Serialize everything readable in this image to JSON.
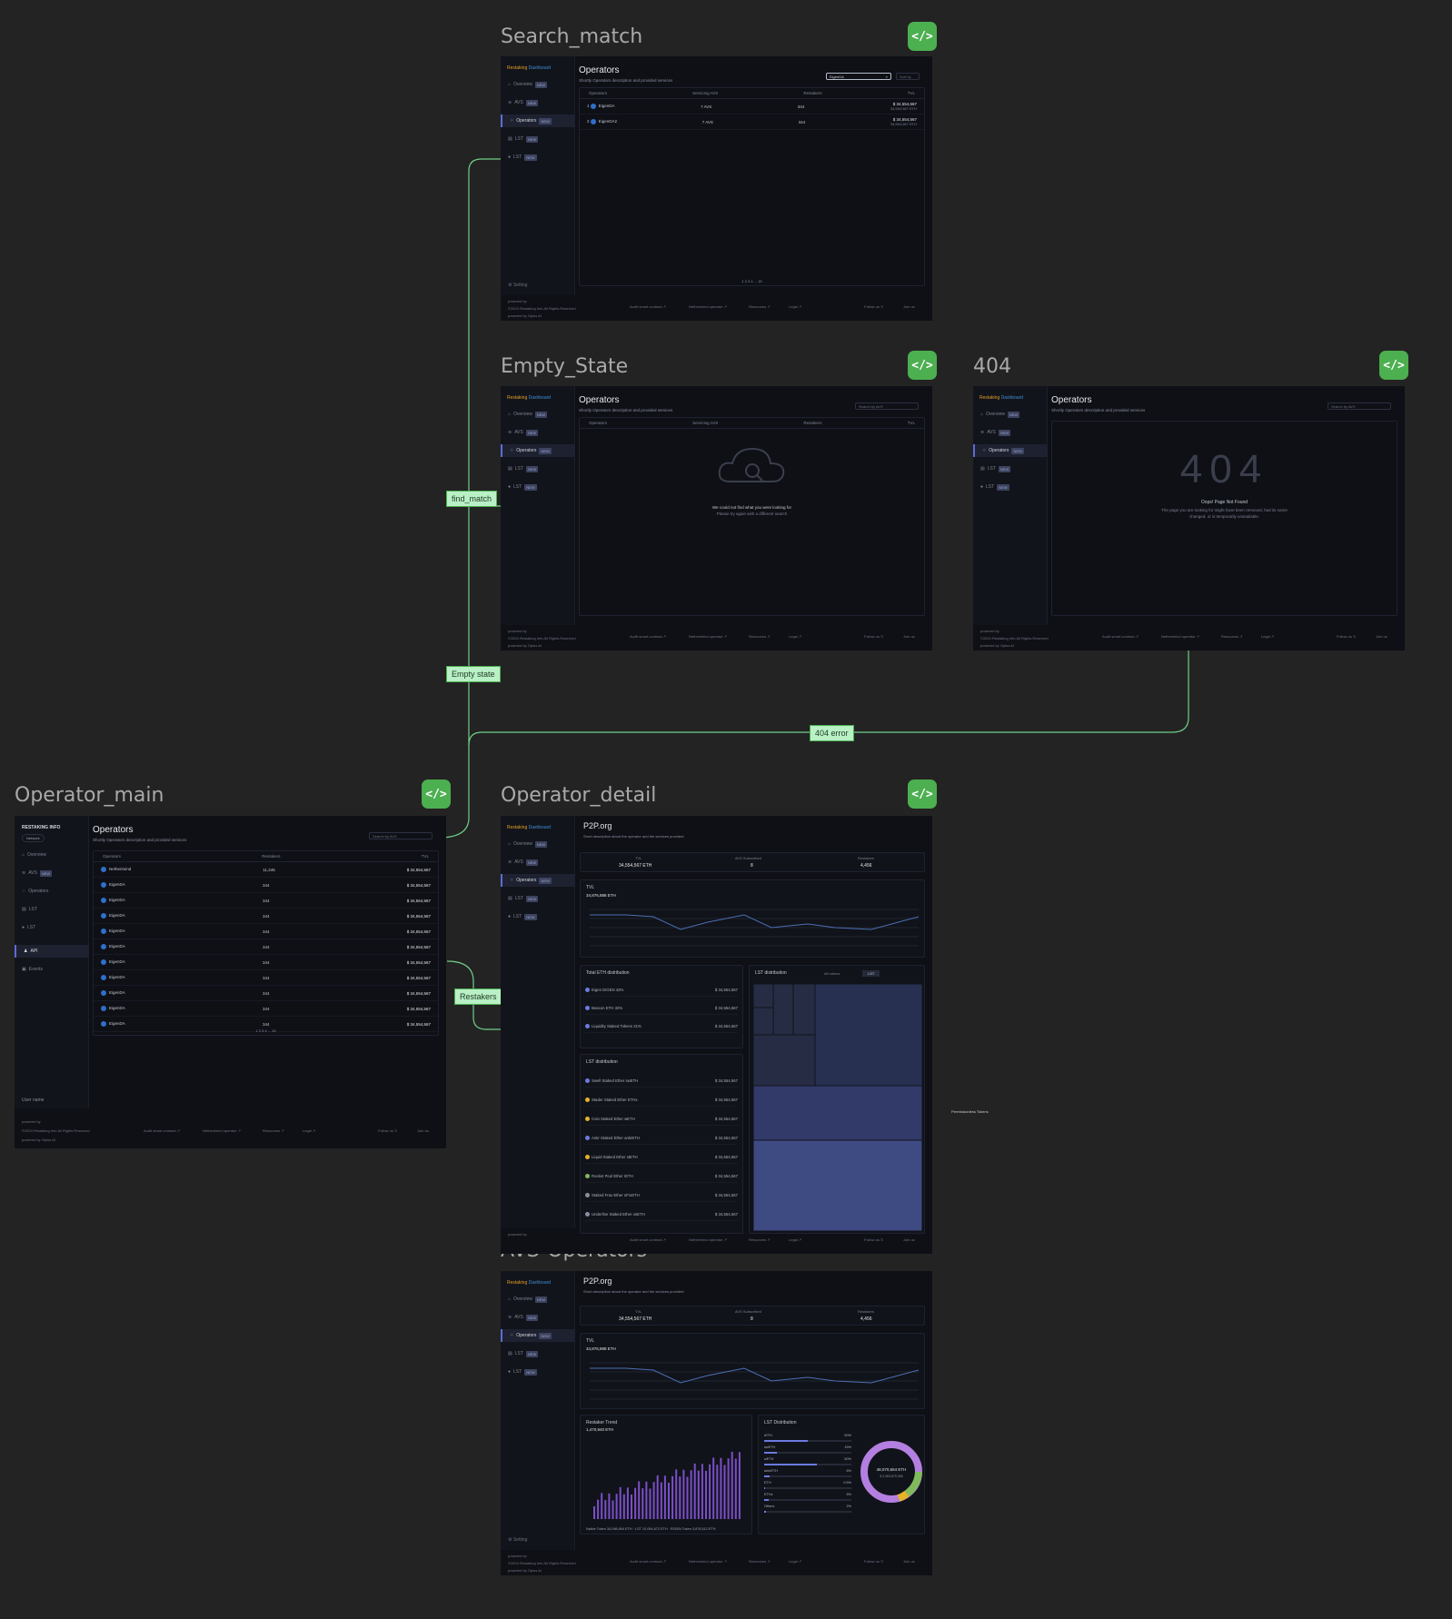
{
  "frames": {
    "search_match": "Search_match",
    "empty_state": "Empty_State",
    "not_found": "404",
    "operator_main": "Operator_main",
    "operator_detail": "Operator_detail",
    "avs_operators": "AVS-Operators"
  },
  "code_icon": "</>",
  "connectors": {
    "find_match": "find_match",
    "empty_state": "Empty state",
    "error_404": "404 error",
    "restakers": "Restakers"
  },
  "sidebar": {
    "brand1": "Restaking",
    "brand2": "Dashboard",
    "overview": "Overview",
    "avs": "AVS",
    "operators": "Operators",
    "lst": "LST",
    "lst2": "LST",
    "setting": "Setting",
    "badge": "NEW"
  },
  "main_sidebar": {
    "brand": "RESTAKING INFO",
    "network": "Network",
    "overview": "Overview",
    "avs": "AVS",
    "operators": "Operators",
    "lst": "LST",
    "lst2": "LST",
    "api": "API",
    "events": "Events",
    "user": "User name"
  },
  "page": {
    "title": "Operators",
    "subtitle": "Shortly Operators description and provided services",
    "search_value": "EigenDA",
    "search_placeholder": "Search by AVS",
    "sort": "Sort by"
  },
  "table": {
    "col_operators": "Operators",
    "col_avs": "Servicing AVS",
    "col_restakers": "Restakers",
    "col_tvl": "TVL"
  },
  "search_rows": [
    {
      "idx": "1",
      "name": "EigenDA",
      "avs": "7 AVS",
      "restakers": "344",
      "tvl": "$ 34,554,567",
      "sub": "34,554,567 ETH"
    },
    {
      "idx": "2",
      "name": "EigenDA2",
      "avs": "7 AVS",
      "restakers": "344",
      "tvl": "$ 34,554,567",
      "sub": "34,554,567 ETH"
    }
  ],
  "pagination": "1  2  3  4  ...  15",
  "empty": {
    "line1": "We could not find what you were looking for",
    "line2": "Please try again with a different search"
  },
  "not_found": {
    "big": "404",
    "title": "Oops! Page Not Found",
    "desc1": "The page you are looking for might have been removed, had its name",
    "desc2": "changed, or is temporarily unavailable."
  },
  "footer": {
    "powered": "powered by",
    "copyright": "©2024 Restaking Info All Rights Reserved",
    "powered2": "powered by Oplus AI",
    "audit": "Audit smart contract ↗",
    "network": "Netherimind operator ↗",
    "resources": "Resources ↗",
    "legal": "Legal ↗",
    "follow": "Follow us 𝕏",
    "join": "Join us"
  },
  "main_rows": [
    {
      "name": "Netherimind",
      "restakers": "11,345",
      "tvl": "$ 34,554,567"
    },
    {
      "name": "EigenDA",
      "restakers": "344",
      "tvl": "$ 34,554,567"
    },
    {
      "name": "EigenDA",
      "restakers": "344",
      "tvl": "$ 34,554,567"
    },
    {
      "name": "EigenDA",
      "restakers": "344",
      "tvl": "$ 34,554,567"
    },
    {
      "name": "EigenDA",
      "restakers": "344",
      "tvl": "$ 34,554,567"
    },
    {
      "name": "EigenDA",
      "restakers": "344",
      "tvl": "$ 34,554,567"
    },
    {
      "name": "EigenDA",
      "restakers": "344",
      "tvl": "$ 34,554,567"
    },
    {
      "name": "EigenDA",
      "restakers": "344",
      "tvl": "$ 34,554,567"
    },
    {
      "name": "EigenDA",
      "restakers": "344",
      "tvl": "$ 34,554,567"
    },
    {
      "name": "EigenDA",
      "restakers": "344",
      "tvl": "$ 34,554,567"
    },
    {
      "name": "EigenDA",
      "restakers": "344",
      "tvl": "$ 34,554,567"
    }
  ],
  "detail": {
    "title": "P2P.org",
    "desc": "Short description about the operator and the services provided",
    "tvl_label": "TVL",
    "tvl": "34,554,567 ETH",
    "avs_label": "AVS Subscribed",
    "avs": "8",
    "restakers_label": "Restakers",
    "restakers": "4,456",
    "chart_tvl": "TVL",
    "chart_value": "34,876,888 ETH",
    "ranges": [
      "1D",
      "1W",
      "1M"
    ],
    "eth_dist": "Total ETH distribution",
    "lst_dist": "LST distribution",
    "lst_tab1": "All tokens",
    "lst_tab2": "LST",
    "side_note": "Permissionless Tokens"
  },
  "eth_rows": [
    {
      "name": "Eigen",
      "token": "EIGEN",
      "pct": "42%",
      "val": "$ 34,554,567",
      "color": "#6b7be0"
    },
    {
      "name": "Beacon",
      "token": "ETH",
      "pct": "32%",
      "val": "$ 34,554,567",
      "color": "#6b7be0"
    },
    {
      "name": "Liquidity Staked Tokens",
      "token": "",
      "pct": "21%",
      "val": "$ 34,554,567",
      "color": "#6b7be0"
    }
  ],
  "lst_rows": [
    {
      "name": "Swell Staked Ether",
      "token": "swETH",
      "val": "$ 34,554,567",
      "color": "#6b7be0"
    },
    {
      "name": "Stader Staked Ether",
      "token": "ETHx",
      "val": "$ 34,554,567",
      "color": "#e5b327"
    },
    {
      "name": "Coin Staked Ether",
      "token": "wETH",
      "val": "$ 34,554,567",
      "color": "#e5b327"
    },
    {
      "name": "Ankr Staked Ether",
      "token": "ankrETH",
      "val": "$ 34,554,567",
      "color": "#6b7be0"
    },
    {
      "name": "Liquid Staked Ether",
      "token": "stETH",
      "val": "$ 34,554,567",
      "color": "#e5b327"
    },
    {
      "name": "Rocket Pool Ether",
      "token": "rETH",
      "val": "$ 34,554,567",
      "color": "#7fb85c"
    },
    {
      "name": "Staked Frax Ether",
      "token": "sFrxETH",
      "val": "$ 34,554,567",
      "color": "#8a8f9e"
    },
    {
      "name": "Underline Staked Ether",
      "token": "osETH",
      "val": "$ 34,554,567",
      "color": "#8a8f9e"
    }
  ],
  "avs": {
    "restaker_trend": "Restaker Trend",
    "trend_value": "1,470,940 ETH",
    "lst_distribution": "LST Distribution",
    "donut_value": "48,070,554 ETH",
    "donut_sub": "$ 2,383,870,356",
    "legend1": "Native Token 34,098,894 ETH",
    "legend2": "LST 10,094,672 ETH",
    "legend3": "EIGEN Token 3,876,512 ETH",
    "dist": [
      {
        "name": "rETH",
        "pct": "50%"
      },
      {
        "name": "swETH",
        "pct": "15%"
      },
      {
        "name": "wETH",
        "pct": "60%"
      },
      {
        "name": "ankrETH",
        "pct": "6%"
      },
      {
        "name": "ETH",
        "pct": "0.5%"
      },
      {
        "name": "ETHx",
        "pct": "5%"
      },
      {
        "name": "Others",
        "pct": "2%"
      }
    ]
  }
}
